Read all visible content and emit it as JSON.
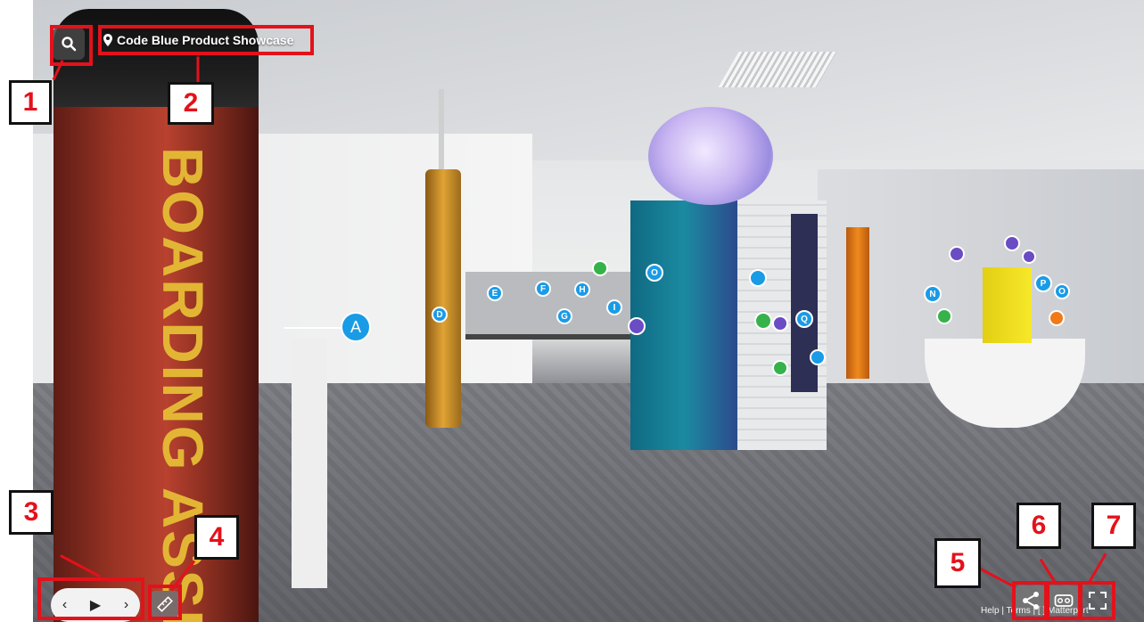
{
  "tour": {
    "title": "Code Blue Product Showcase"
  },
  "scene": {
    "pole_text": "BOARDING ASSI",
    "hotspots": [
      "A",
      "D",
      "E",
      "F",
      "G",
      "H",
      "I",
      "O",
      "Q",
      "N",
      "P",
      "O"
    ]
  },
  "controls": {
    "prev": "‹",
    "play": "▶",
    "next": "›"
  },
  "footer": {
    "text": "Help | Terms | [ ] Matterport"
  },
  "callouts": [
    "1",
    "2",
    "3",
    "4",
    "5",
    "6",
    "7"
  ],
  "colors": {
    "callout_red": "#e4111b",
    "hotspot_blue": "#1a9be6",
    "hotspot_green": "#36b24a",
    "hotspot_purple": "#6a4cc4"
  },
  "icons": {
    "search": "search-icon",
    "location": "location-pin-icon",
    "measure": "ruler-icon",
    "share": "share-icon",
    "vr": "vr-headset-icon",
    "fullscreen": "fullscreen-icon"
  }
}
